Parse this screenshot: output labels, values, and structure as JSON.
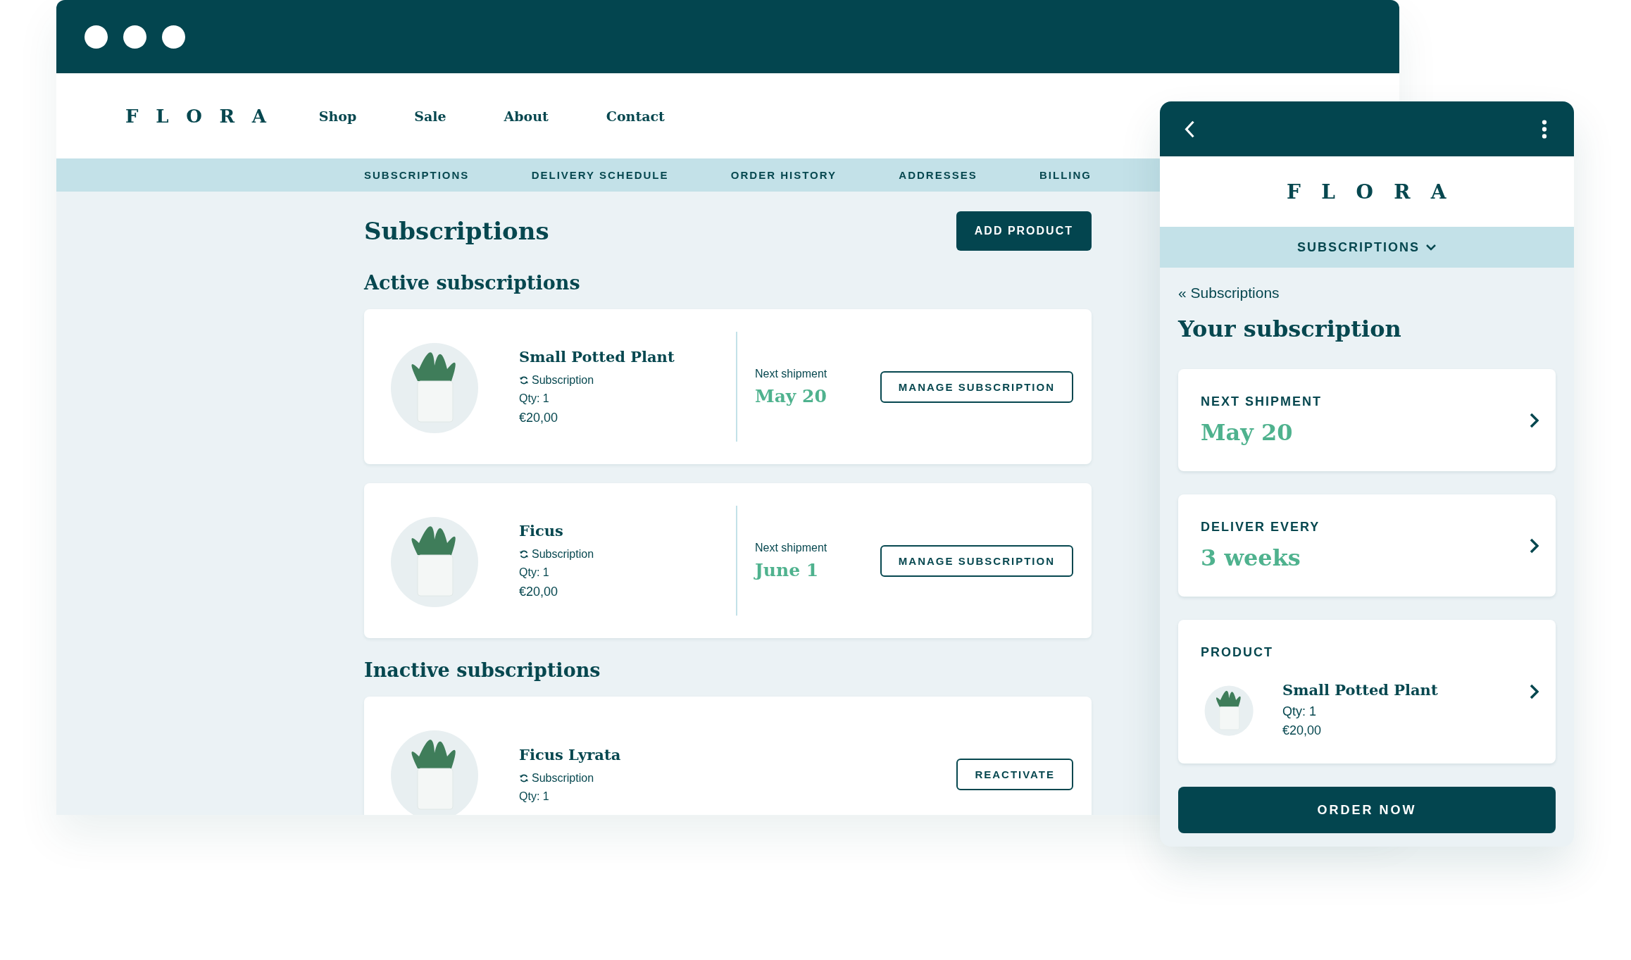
{
  "desktop": {
    "logo": "FLORA",
    "nav": [
      "Shop",
      "Sale",
      "About",
      "Contact"
    ],
    "subnav": [
      "SUBSCRIPTIONS",
      "DELIVERY SCHEDULE",
      "ORDER HISTORY",
      "ADDRESSES",
      "BILLING"
    ],
    "title": "Subscriptions",
    "add_button": "ADD PRODUCT",
    "sections": [
      {
        "heading": "Active subscriptions",
        "items": [
          {
            "name": "Small Potted Plant",
            "type": "Subscription",
            "qty": "Qty: 1",
            "price": "€20,00",
            "next_label": "Next shipment",
            "next_date": "May 20",
            "button": "MANAGE SUBSCRIPTION"
          },
          {
            "name": "Ficus",
            "type": "Subscription",
            "qty": "Qty: 1",
            "price": "€20,00",
            "next_label": "Next shipment",
            "next_date": "June 1",
            "button": "MANAGE SUBSCRIPTION"
          }
        ]
      },
      {
        "heading": "Inactive subscriptions",
        "items": [
          {
            "name": "Ficus Lyrata",
            "type": "Subscription",
            "qty": "Qty: 1",
            "button": "REACTIVATE"
          }
        ]
      }
    ]
  },
  "mobile": {
    "logo": "FLORA",
    "menu": "SUBSCRIPTIONS",
    "back_link": "« Subscriptions",
    "title": "Your subscription",
    "cards": [
      {
        "kind": "value",
        "label": "NEXT SHIPMENT",
        "value": "May 20"
      },
      {
        "kind": "value",
        "label": "DELIVER EVERY",
        "value": "3 weeks"
      },
      {
        "kind": "product",
        "label": "PRODUCT",
        "name": "Small Potted Plant",
        "qty": "Qty: 1",
        "price": "€20,00"
      }
    ],
    "order_button": "ORDER NOW"
  }
}
